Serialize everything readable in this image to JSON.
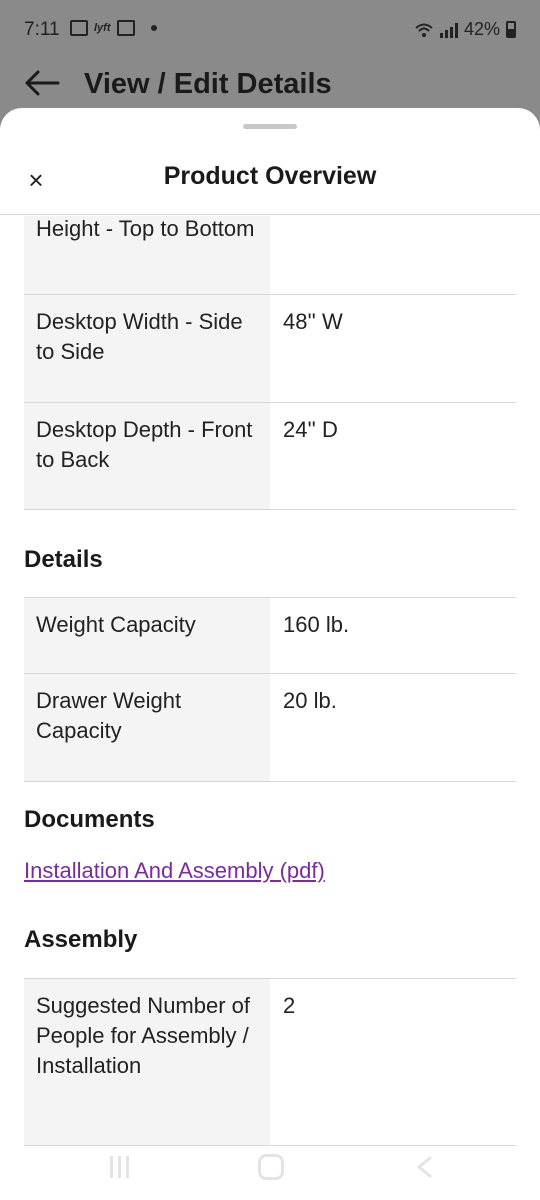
{
  "status_bar": {
    "time": "7:11",
    "battery": "42%",
    "notification_icons": [
      "image-icon",
      "lyft-icon",
      "calendar-icon"
    ]
  },
  "app_bar": {
    "title": "View / Edit Details"
  },
  "sheet": {
    "title": "Product Overview",
    "close_icon": "×"
  },
  "dimensions": [
    {
      "label": "Height - Top to Bottom",
      "value": ""
    },
    {
      "label": "Desktop Width - Side to Side",
      "value": "48'' W"
    },
    {
      "label": "Desktop Depth - Front to Back",
      "value": "24'' D"
    }
  ],
  "details": {
    "heading": "Details",
    "rows": [
      {
        "label": "Weight Capacity",
        "value": "160 lb."
      },
      {
        "label": "Drawer Weight Capacity",
        "value": "20 lb."
      }
    ]
  },
  "documents": {
    "heading": "Documents",
    "link": "Installation And Assembly (pdf)"
  },
  "assembly": {
    "heading": "Assembly",
    "rows": [
      {
        "label": "Suggested Number of People for Assembly / Installation",
        "value": "2"
      }
    ]
  },
  "colors": {
    "link": "#7b2c9c",
    "label_bg": "#f4f4f4",
    "divider": "#d8d8d8"
  }
}
